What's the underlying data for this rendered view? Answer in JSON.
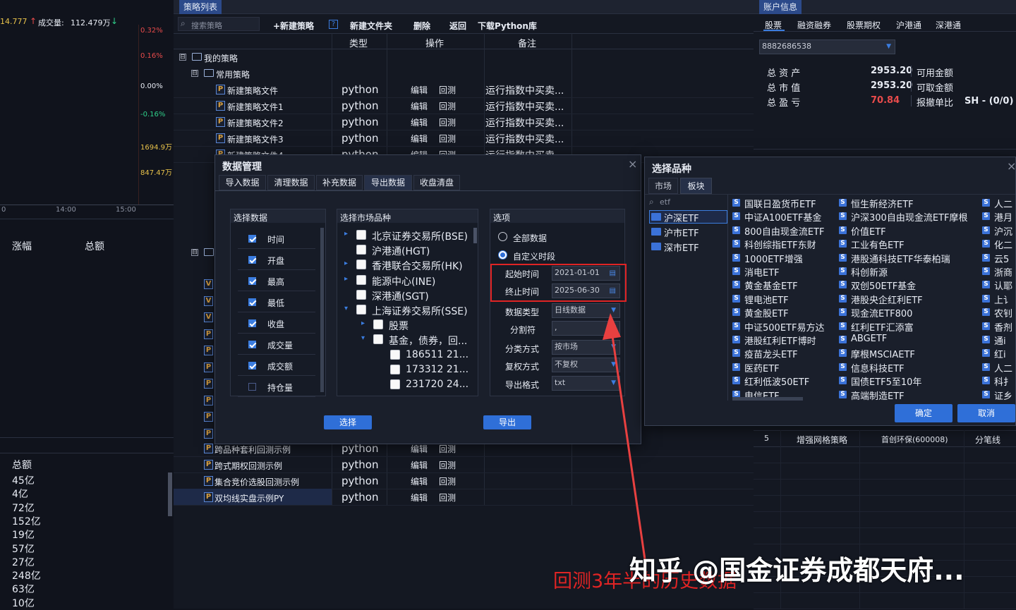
{
  "ticker": {
    "vol_left": "14.777",
    "vol_label": "成交量:",
    "vol_value": "112.479万",
    "arrow_up": "↑",
    "arrow_down": "↓"
  },
  "chart_scale": {
    "pct": [
      "0.32%",
      "0.16%",
      "0.00%",
      "-0.16%"
    ],
    "vol": [
      "1694.9万",
      "847.47万"
    ],
    "times": [
      "0",
      "14:00",
      "15:00"
    ]
  },
  "left_headers": {
    "zhangfu": "涨幅",
    "zonge": "总额",
    "zonge2": "总额"
  },
  "left_amounts": [
    "45亿",
    "4亿",
    "72亿",
    "152亿",
    "19亿",
    "57亿",
    "27亿",
    "248亿",
    "63亿",
    "10亿"
  ],
  "strategy": {
    "tab": "策略列表",
    "search_placeholder": "搜索策略",
    "toolbar": {
      "new": "+新建策略",
      "help": "?",
      "new_folder": "新建文件夹",
      "delete": "删除",
      "back": "返回",
      "download": "下载Python库"
    },
    "cols": {
      "type": "类型",
      "op": "操作",
      "note": "备注"
    },
    "tree": {
      "my": "我的策略",
      "common": "常用策略",
      "toggle": "⊟"
    },
    "items": [
      {
        "name": "新建策略文件",
        "type": "python",
        "edit": "编辑",
        "back": "回测",
        "note": "运行指数中买卖..."
      },
      {
        "name": "新建策略文件1",
        "type": "python",
        "edit": "编辑",
        "back": "回测",
        "note": "运行指数中买卖..."
      },
      {
        "name": "新建策略文件2",
        "type": "python",
        "edit": "编辑",
        "back": "回测",
        "note": "运行指数中买卖..."
      },
      {
        "name": "新建策略文件3",
        "type": "python",
        "edit": "编辑",
        "back": "回测",
        "note": "运行指数中买卖..."
      }
    ],
    "partial": {
      "name": "新建策略文件4",
      "type": "python",
      "edit": "编辑",
      "back": "回测",
      "note": "运行指数中买卖..."
    },
    "bottom_items": [
      {
        "name": "跨品种套利回测示例",
        "type": "python",
        "edit": "编辑",
        "back": "回测"
      },
      {
        "name": "跨式期权回测示例",
        "type": "python",
        "edit": "编辑",
        "back": "回测"
      },
      {
        "name": "集合竞价选股回测示例",
        "type": "python",
        "edit": "编辑",
        "back": "回测"
      },
      {
        "name": "双均线实盘示例PY",
        "type": "python",
        "edit": "编辑",
        "back": "回测"
      }
    ],
    "icon_p": "P",
    "icon_v": "V"
  },
  "account": {
    "tab": "账户信息",
    "subtabs": [
      "股票",
      "融资融券",
      "股票期权",
      "沪港通",
      "深港通"
    ],
    "account_no": "8882686538",
    "rows": [
      {
        "label": "总 资 产",
        "value": "2953.20",
        "right": "可用金额"
      },
      {
        "label": "总 市 值",
        "value": "2953.20",
        "right": "可取金额"
      },
      {
        "label": "总 盈 亏",
        "value": "70.84",
        "right": "报撤单比"
      }
    ],
    "ratio": "SH - (0/0) /"
  },
  "orders": {
    "row": {
      "no": "5",
      "name": "增强网格策略",
      "stock": "首创环保(600008)",
      "type": "分笔线"
    }
  },
  "data_dialog": {
    "title": "数据管理",
    "close": "×",
    "tabs": [
      "导入数据",
      "清理数据",
      "补充数据",
      "导出数据",
      "收盘清盘"
    ],
    "select_data": {
      "title": "选择数据",
      "fields": [
        {
          "label": "时间",
          "checked": true
        },
        {
          "label": "开盘",
          "checked": true
        },
        {
          "label": "最高",
          "checked": true
        },
        {
          "label": "最低",
          "checked": true
        },
        {
          "label": "收盘",
          "checked": true
        },
        {
          "label": "成交量",
          "checked": true
        },
        {
          "label": "成交额",
          "checked": true
        },
        {
          "label": "持仓量",
          "checked": false
        }
      ]
    },
    "market": {
      "title": "选择市场品种",
      "items": [
        {
          "label": "北京证券交易所(BSE)",
          "arrow": "▸"
        },
        {
          "label": "沪港通(HGT)",
          "arrow": ""
        },
        {
          "label": "香港联合交易所(HK)",
          "arrow": "▸"
        },
        {
          "label": "能源中心(INE)",
          "arrow": "▸"
        },
        {
          "label": "深港通(SGT)",
          "arrow": ""
        },
        {
          "label": "上海证券交易所(SSE)",
          "arrow": "▾"
        },
        {
          "label": "股票",
          "arrow": "▸"
        },
        {
          "label": "基金，债券，回...",
          "arrow": "▾"
        },
        {
          "label": "186511 21...",
          "arrow": ""
        },
        {
          "label": "173312 21...",
          "arrow": ""
        },
        {
          "label": "231720 24...",
          "arrow": ""
        }
      ]
    },
    "options": {
      "title": "选项",
      "all": "全部数据",
      "custom": "自定义时段",
      "start_label": "起始时间",
      "start_value": "2021-01-01",
      "end_label": "终止时间",
      "end_value": "2025-06-30",
      "datatype_label": "数据类型",
      "datatype_value": "日线数据",
      "sep_label": "分割符",
      "sep_value": ",",
      "classify_label": "分类方式",
      "classify_value": "按市场",
      "adjust_label": "复权方式",
      "adjust_value": "不复权",
      "format_label": "导出格式",
      "format_value": "txt"
    },
    "select_btn": "选择",
    "export_btn": "导出"
  },
  "picker": {
    "title": "选择品种",
    "close": "×",
    "tabs": [
      "市场",
      "板块"
    ],
    "search": "etf",
    "left": [
      "沪深ETF",
      "沪市ETF",
      "深市ETF"
    ],
    "col1": [
      "国联日盈货币ETF",
      "中证A100ETF基金",
      "800自由现金流ETF",
      "科创综指ETF东财",
      "1000ETF增强",
      "消电ETF",
      "黄金基金ETF",
      "锂电池ETF",
      "黄金股ETF",
      "中证500ETF易方达",
      "港股红利ETF博时",
      "疫苗龙头ETF",
      "医药ETF",
      "红利低波50ETF",
      "电信ETF"
    ],
    "col2": [
      "恒生新经济ETF",
      "沪深300自由现金流ETF摩根",
      "价值ETF",
      "工业有色ETF",
      "港股通科技ETF华泰柏瑞",
      "科创新源",
      "双创50ETF基金",
      "港股央企红利ETF",
      "现金流ETF800",
      "红利ETF汇添富",
      "ABGETF",
      "摩根MSCIAETF",
      "信息科技ETF",
      "国债ETF5至10年",
      "高端制造ETF"
    ],
    "col3": [
      "人二",
      "港月",
      "沪沉",
      "化二",
      "云5",
      "浙商",
      "认耶",
      "上讠",
      "农钊",
      "香剂",
      "通i",
      "红i",
      "人二",
      "科扌",
      "证乡"
    ],
    "s": "S",
    "ok": "确定",
    "cancel": "取消"
  },
  "annotation": {
    "text": "回测3年半的历史数据"
  },
  "watermark": {
    "text": "知乎 @国金证券成都天府..."
  },
  "colors": {
    "accent": "#2f6fd8",
    "red": "#e84b4b",
    "annotation": "#e02424"
  }
}
